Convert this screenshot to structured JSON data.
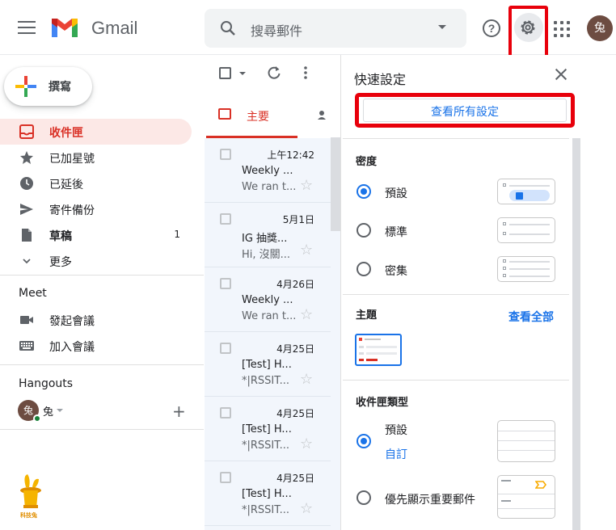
{
  "header": {
    "logo_text": "Gmail",
    "search_placeholder": "搜尋郵件",
    "avatar_initial": "兔",
    "help_glyph": "?"
  },
  "sidebar": {
    "compose_label": "撰寫",
    "items": [
      {
        "label": "收件匣",
        "count": ""
      },
      {
        "label": "已加星號",
        "count": ""
      },
      {
        "label": "已延後",
        "count": ""
      },
      {
        "label": "寄件備份",
        "count": ""
      },
      {
        "label": "草稿",
        "count": "1"
      },
      {
        "label": "更多",
        "count": ""
      }
    ],
    "meet_title": "Meet",
    "meet_items": [
      "發起會議",
      "加入會議"
    ],
    "hangouts_title": "Hangouts",
    "hangouts_user": "兔",
    "hangouts_avatar": "兔",
    "watermark_text": "科技兔"
  },
  "mail": {
    "primary_tab": "主要",
    "rows": [
      {
        "date": "上午12:42",
        "sender": "Weekly ...",
        "snippet": "We ran t..."
      },
      {
        "date": "5月1日",
        "sender": "IG 抽獎...",
        "snippet": "Hi, 沒關..."
      },
      {
        "date": "4月26日",
        "sender": "Weekly ...",
        "snippet": "We ran t..."
      },
      {
        "date": "4月25日",
        "sender": "[Test] H...",
        "snippet": "*|RSSIT..."
      },
      {
        "date": "4月25日",
        "sender": "[Test] H...",
        "snippet": "*|RSSIT..."
      },
      {
        "date": "4月25日",
        "sender": "[Test] H...",
        "snippet": "*|RSSIT..."
      }
    ]
  },
  "quick_settings": {
    "title": "快速設定",
    "see_all_button": "查看所有設定",
    "density_title": "密度",
    "density_options": [
      "預設",
      "標準",
      "密集"
    ],
    "density_selected": "預設",
    "theme_title": "主題",
    "theme_link": "查看全部",
    "inbox_type_title": "收件匣類型",
    "inbox_default": "預設",
    "inbox_customize": "自訂",
    "inbox_important_first": "優先顯示重要郵件"
  },
  "colors": {
    "accent_red": "#d93025",
    "highlight_box": "#e8000b",
    "link_blue": "#1a73e8"
  }
}
